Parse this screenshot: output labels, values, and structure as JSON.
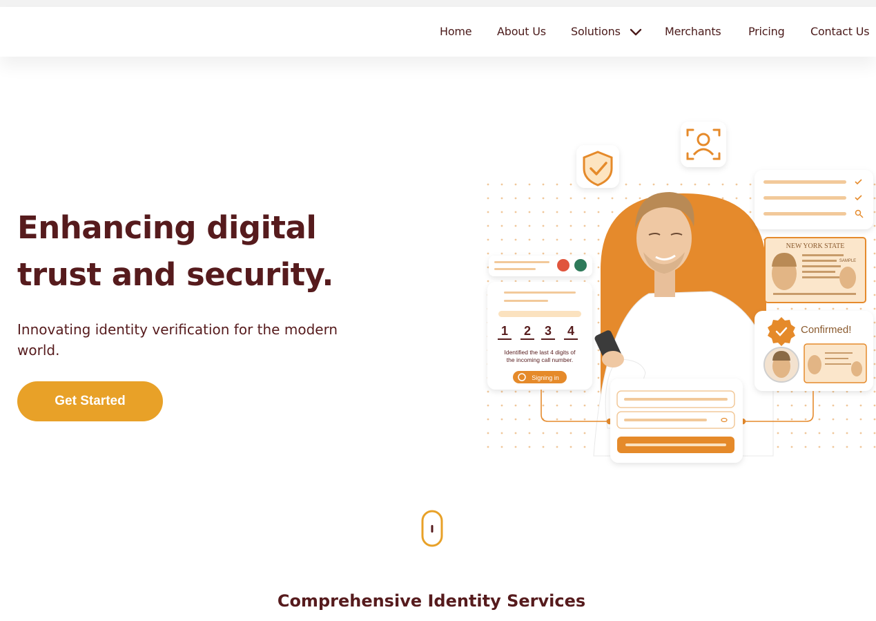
{
  "nav": {
    "items": [
      {
        "label": "Home"
      },
      {
        "label": "About Us"
      },
      {
        "label": "Solutions"
      },
      {
        "label": "Merchants"
      },
      {
        "label": "Pricing"
      },
      {
        "label": "Contact Us"
      }
    ]
  },
  "hero": {
    "title_line1": "Enhancing digital",
    "title_line2": "trust and security.",
    "subtitle": "Innovating identity verification for the modern world.",
    "cta_label": "Get Started"
  },
  "illustration": {
    "digits": [
      "1",
      "2",
      "3",
      "4"
    ],
    "call_caption_line1": "Identified the last 4 digits of",
    "call_caption_line2": "the incoming call number.",
    "signing_label": "Signing in",
    "confirmed_label": "Confirmed!",
    "id_card_header": "NEW YORK STATE",
    "id_card_sample": "SAMPLE"
  },
  "section": {
    "title": "Comprehensive Identity Services"
  },
  "colors": {
    "brand_dark": "#561b1d",
    "accent_orange": "#e8a128",
    "blob_orange": "#e58a2c"
  }
}
